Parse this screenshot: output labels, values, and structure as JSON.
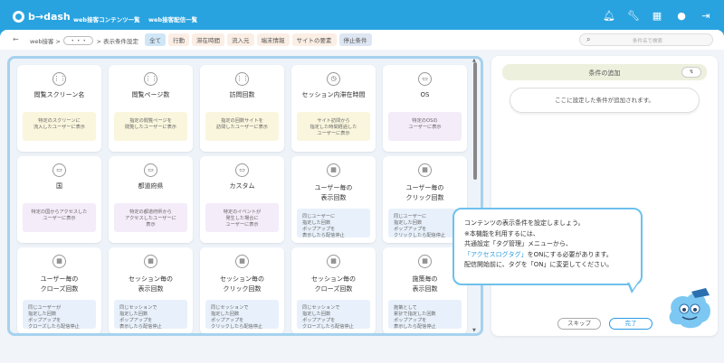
{
  "header": {
    "logo": "b→dash",
    "nav": [
      "web接客コンテンツ一覧",
      "web接客配信一覧"
    ],
    "icons": [
      "bell-icon",
      "wrench-icon",
      "grid-icon",
      "chat-icon",
      "logout-icon"
    ]
  },
  "subbar": {
    "back": "←",
    "breadcrumb_root": "web接客 >",
    "breadcrumb_dots": "・・・",
    "breadcrumb_current": "> 表示条件設定",
    "tabs": [
      {
        "label": "全て",
        "bg": "#cfe6f7"
      },
      {
        "label": "行動",
        "bg": "#fbeee4"
      },
      {
        "label": "滞在時間",
        "bg": "#fbeee4"
      },
      {
        "label": "流入元",
        "bg": "#fbeee4"
      },
      {
        "label": "端末情報",
        "bg": "#fbeee4"
      },
      {
        "label": "サイトの要素",
        "bg": "#fbeee4"
      },
      {
        "label": "停止条件",
        "bg": "#dde6f2"
      }
    ],
    "search_placeholder": "条件名で検索"
  },
  "cards": [
    {
      "icon": "footprints-icon",
      "glyph": "⋮⋮",
      "title": "閲覧スクリーン名",
      "desc": "特定のスクリーンに\n流入したユーザーに表示",
      "tone": "y"
    },
    {
      "icon": "footprints-icon",
      "glyph": "⋮⋮",
      "title": "閲覧ページ数",
      "desc": "指定の閲覧ページを\n閲覧したユーザーに表示",
      "tone": "y"
    },
    {
      "icon": "footprints-icon",
      "glyph": "⋮⋮",
      "title": "訪問回数",
      "desc": "指定の回数サイトを\n訪問したユーザーに表示",
      "tone": "y"
    },
    {
      "icon": "clock-icon",
      "glyph": "◷",
      "title": "セッション内滞在時間",
      "desc": "サイト訪問から\n指定した時間経過した\nユーザーに表示",
      "tone": "y"
    },
    {
      "icon": "monitor-icon",
      "glyph": "▭",
      "title": "OS",
      "desc": "特定のOSの\nユーザーに表示",
      "tone": "p"
    },
    {
      "icon": "monitor-icon",
      "glyph": "▭",
      "title": "国",
      "desc": "特定の国からアクセスした\nユーザーに表示",
      "tone": "p"
    },
    {
      "icon": "monitor-icon",
      "glyph": "▭",
      "title": "都道府県",
      "desc": "特定の都道府県から\nアクセスしたユーザーに\n表示",
      "tone": "p"
    },
    {
      "icon": "monitor-icon",
      "glyph": "▭",
      "title": "カスタム",
      "desc": "特定のイベントが\n発生した場合に\nユーザーに表示",
      "tone": "p"
    },
    {
      "icon": "calendar-icon",
      "glyph": "▦",
      "title": "ユーザー毎の\n表示回数",
      "desc": "同じユーザーに\n指定した回数\nポップアップを\n表示したら配信停止",
      "tone": "b"
    },
    {
      "icon": "calendar-icon",
      "glyph": "▦",
      "title": "ユーザー毎の\nクリック回数",
      "desc": "同じユーザーに\n指定した回数\nポップアップを\nクリックしたら配信停止",
      "tone": "b"
    },
    {
      "icon": "calendar-icon",
      "glyph": "▦",
      "title": "ユーザー毎の\nクローズ回数",
      "desc": "同じユーザーが\n指定した回数\nポップアップを\nクローズしたら配信停止",
      "tone": "b"
    },
    {
      "icon": "calendar-icon",
      "glyph": "▦",
      "title": "セッション毎の\n表示回数",
      "desc": "同じセッションで\n指定した回数\nポップアップを\n表示したら配信停止",
      "tone": "b"
    },
    {
      "icon": "calendar-icon",
      "glyph": "▦",
      "title": "セッション毎の\nクリック回数",
      "desc": "同じセッションで\n指定した回数\nポップアップを\nクリックしたら配信停止",
      "tone": "b"
    },
    {
      "icon": "calendar-icon",
      "glyph": "▦",
      "title": "セッション毎の\nクローズ回数",
      "desc": "同じセッションで\n指定した回数\nポップアップを\nクローズしたら配信停止",
      "tone": "b"
    },
    {
      "icon": "calendar-icon",
      "glyph": "▦",
      "title": "施策毎の\n表示回数",
      "desc": "施策として\n累計で指定した回数\nポップアップを\n表示したら配信停止",
      "tone": "b"
    }
  ],
  "right": {
    "cond_title": "条件の追加",
    "cond_btn": "↯",
    "cond_placeholder": "ここに設定した条件が追加されます。"
  },
  "tooltip": {
    "line1": "コンテンツの表示条件を設定しましょう。",
    "line2": "※本機能を利用するには、",
    "line3": "共通設定「タグ管理」メニューから、",
    "line4_hl": "「アクセスログタグ」",
    "line4_rest": "をONにする必要があります。",
    "line5": "配信開始前に、タグを「ON」に変更してください。"
  },
  "buttons": {
    "skip": "スキップ",
    "done": "完了"
  }
}
